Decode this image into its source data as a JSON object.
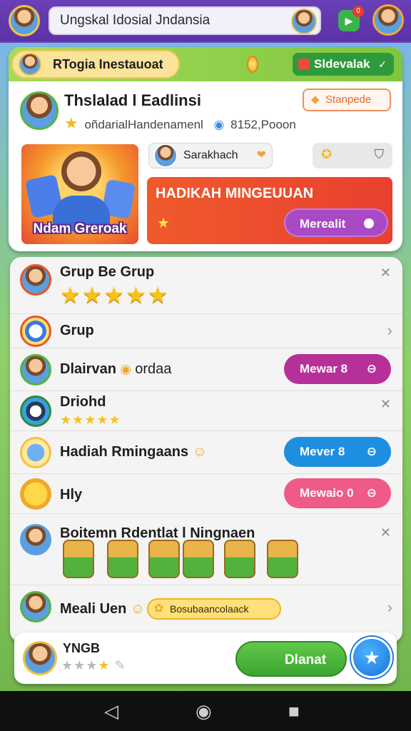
{
  "topbar": {
    "search_text": "Ungskal Idosial Jndansia",
    "notif_count": "0"
  },
  "header_card": {
    "pill_title": "RTogia Inestauoat",
    "dropdown_label": "Sldevalak",
    "profile_name": "Thslalad l Eadlinsi",
    "profile_sub": "oñdarialHandenamenl",
    "profile_points": "8152,Pooon",
    "status_label": "Stanpede",
    "promo_label": "Ndam Greroak",
    "friend_name": "Sarakhach",
    "reward_title": "HADIKAH MINGEUUAN",
    "reward_button": "Merealit"
  },
  "list": {
    "rows": [
      {
        "title": "Grup Be Grup",
        "stars": "★★★★★"
      },
      {
        "title": "Grup"
      },
      {
        "title": "Dlairvan",
        "suffix": "ordaa",
        "button": "Mewar 8"
      },
      {
        "title": "Driohd",
        "stars": "★★★★★"
      },
      {
        "title": "Hadiah Rmingaans",
        "button": "Mever 8"
      },
      {
        "title": "Hly",
        "button": "Mewaio 0"
      },
      {
        "title": "Boitemn  Rdentlat l Ningnaen"
      },
      {
        "title": "Meali Uen",
        "badge": "Bosubaancolaack"
      }
    ]
  },
  "bottom": {
    "name": "YNGB",
    "stars": "★★★",
    "gold_star": "★",
    "button": "Dlanat"
  },
  "colors": {
    "purple_btn": "#a94ac5",
    "blue_btn": "#1e8fe0",
    "pink_btn": "#f05a86",
    "green_header": "#7fc63e",
    "reward_red": "#e9402f"
  }
}
